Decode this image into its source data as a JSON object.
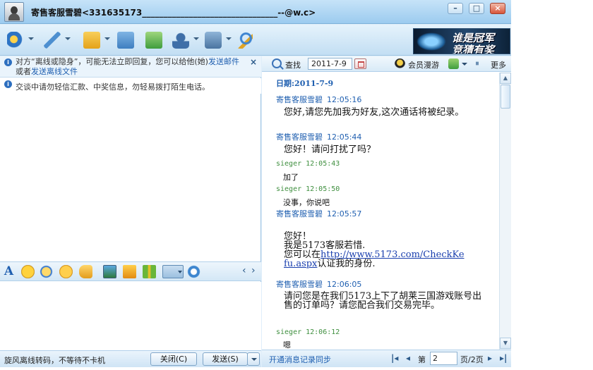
{
  "window": {
    "title": "寄售客服雪碧<331635173________________________________--@w.c>",
    "min_glyph": "–",
    "max_glyph": "□",
    "close_glyph": "×"
  },
  "toolbar": {
    "icons": [
      "video-icon",
      "voice-icon",
      "send-file-icon",
      "picture-icon",
      "document-icon",
      "user-info-icon",
      "app-icon",
      "search-icon"
    ]
  },
  "ad": {
    "line1": "谁是冠军",
    "line2": "竞猜有奖"
  },
  "notices": {
    "offline_prefix": "对方“离线或隐身”，可能无法立即回复，您可以给他(她)",
    "send_mail_link": "发送邮件",
    "or_text": "或者",
    "send_offline_file_link": "发送离线文件",
    "close_glyph": "×",
    "safety": "交谈中请勿轻信汇款、中奖信息，勿轻易拨打陌生电话。",
    "info_glyph": "i"
  },
  "input_toolbar": {
    "font_glyph": "A",
    "prev_glyph": "‹",
    "next_glyph": "›"
  },
  "left_status": {
    "text": "旋风离线转码，不等待不卡机",
    "close_label": "关闭(C)",
    "send_label": "发送(S)"
  },
  "history_toolbar": {
    "find_label": "查找",
    "date_value": "2011-7-9",
    "member_label": "会员漫游",
    "more_label": "更多"
  },
  "history": {
    "date_header": "日期:2011-7-9",
    "messages": [
      {
        "sender": "寄售客服雪碧",
        "time": "12:05:16",
        "text": "您好,请您先加我为好友,这次通话将被纪录。"
      },
      {
        "sender": "寄售客服雪碧",
        "time": "12:05:44",
        "text": "您好！请问打扰了吗？"
      },
      {
        "sender": "sieger",
        "time": "12:05:43",
        "text": "加了"
      },
      {
        "sender": "sieger",
        "time": "12:05:50",
        "text": "没事，你说吧"
      },
      {
        "sender": "寄售客服雪碧",
        "time": "12:05:57",
        "line1": "您好！",
        "line2": "我是5173客服若惜.",
        "line3_pre": "您可以在",
        "link_part1": "http://www.5173.com/CheckKe",
        "link_part2": "fu.aspx",
        "line4_post": "认证我的身份."
      },
      {
        "sender": "寄售客服雪碧",
        "time": "12:06:05",
        "text": "请问您是在我们5173上下了胡莱三国游戏账号出售的订单吗？请您配合我们交易完毕。"
      },
      {
        "sender": "sieger",
        "time": "12:06:12",
        "text": "嗯"
      }
    ]
  },
  "scrollbar": {
    "up_glyph": "▲",
    "down_glyph": "▼"
  },
  "footer": {
    "sync_link": "开通消息记录同步",
    "first_glyph": "|◂",
    "prev_glyph": "◂",
    "page_prefix": "第",
    "page_value": "2",
    "page_suffix": "页/2页",
    "next_glyph": "▸",
    "last_glyph": "▸|"
  }
}
